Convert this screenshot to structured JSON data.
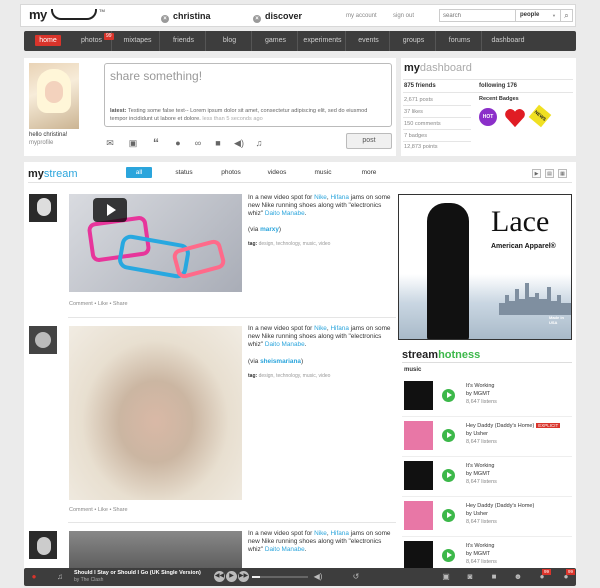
{
  "topbar": {
    "logo": "my",
    "logo_tm": "TM",
    "user1": "christina",
    "user2": "discover",
    "my_account": "my account",
    "sign_out": "sign out",
    "search_placeholder": "search",
    "search_scope": "people",
    "search_scope_arrow": "▼",
    "search_icon": "🔍"
  },
  "nav": {
    "items": [
      {
        "label": "home",
        "active": true
      },
      {
        "label": "photos",
        "badge": "99"
      },
      {
        "label": "mixtapes"
      },
      {
        "label": "friends"
      },
      {
        "label": "blog"
      },
      {
        "label": "games"
      },
      {
        "label": "experiments"
      },
      {
        "label": "events"
      },
      {
        "label": "groups"
      },
      {
        "label": "forums"
      },
      {
        "label": "dashboard"
      }
    ]
  },
  "share": {
    "hello": "hello christina!",
    "myprofile": "myprofile",
    "placeholder": "share something!",
    "latest_label": "latest:",
    "latest_text": "Testing some false text-- Lorem ipsum dolor sit amet, consectetur adipiscing elit, sed do eiusmod tempor incididunt ut labore et dolore.",
    "latest_time": "less than 5 seconds ago",
    "post_label": "post",
    "icons": [
      "mail-icon",
      "photo-icon",
      "quote-icon",
      "chat-icon",
      "link-icon",
      "video-icon",
      "audio-icon",
      "music-icon"
    ]
  },
  "dashboard": {
    "title_bold": "my",
    "title_light": "dashboard",
    "friends": "875 friends",
    "following": "following 176",
    "stats": [
      "2,671 posts",
      "37 likes",
      "150 comments",
      "7 badges",
      "12,873 points"
    ],
    "badges_title": "Recent Badges",
    "badge_hot": "HOT",
    "badge_news": "NEWS"
  },
  "stream": {
    "title_bold": "my",
    "title_light": "stream",
    "tabs": [
      "all",
      "status",
      "photos",
      "videos",
      "music",
      "more"
    ],
    "view_icons": [
      "▶",
      "▤",
      "▦"
    ],
    "posts": [
      {
        "text_pre": "In a new video spot for ",
        "link1": "Nike",
        "mid1": ", ",
        "link2": "Hifana",
        "text_mid": " jams on some new Nike running shoes along with \"electronics whiz\" ",
        "link3": "Daito Manabe",
        "text_end": ".",
        "via_pre": "(via ",
        "via_user": "marxy",
        "via_end": ")",
        "tags_label": "tag:",
        "tags": "design, technology, music, video",
        "actions": "Comment  •  Like  •  Share"
      },
      {
        "text_pre": "In a new video spot for ",
        "link1": "Nike",
        "mid1": ", ",
        "link2": "Hifana",
        "text_mid": " jams on some new Nike running shoes along with \"electronics whiz\" ",
        "link3": "Daito Manabe",
        "text_end": ".",
        "via_pre": "(via ",
        "via_user": "sheismariana",
        "via_end": ")",
        "tags_label": "tag:",
        "tags": "design, technology, music, video",
        "actions": "Comment  •  Like  •  Share"
      },
      {
        "text_pre": "In a new video spot for ",
        "link1": "Nike",
        "mid1": ", ",
        "link2": "Hifana",
        "text_mid": " jams on some new Nike running shoes along with \"electronics whiz\" ",
        "link3": "Daito Manabe",
        "text_end": "."
      }
    ]
  },
  "ad": {
    "title": "Lace",
    "subtitle": "American Apparel®",
    "badge": "Made in USA"
  },
  "hotness": {
    "title_bold": "stream",
    "title_green": "hotness",
    "music_label": "music",
    "tracks": [
      {
        "title": "It's Working",
        "artist": "by MGMT",
        "listens": "8,647 listens"
      },
      {
        "title": "Hey Daddy (Daddy's Home)",
        "artist": "by Usher",
        "listens": "8,647 listens",
        "explicit": "EXPLICIT"
      },
      {
        "title": "It's Working",
        "artist": "by MGMT",
        "listens": "8,647 listens"
      },
      {
        "title": "Hey Daddy (Daddy's Home)",
        "artist": "by Usher",
        "listens": "8,647 listens"
      },
      {
        "title": "It's Working",
        "artist": "by MGMT",
        "listens": "8,647 listens"
      }
    ]
  },
  "player": {
    "song": "Should I Stay or Should I Go (UK Single Version)",
    "artist": "by The Clash",
    "progress": 0.15,
    "badge1": "99",
    "badge2": "99"
  },
  "colors": {
    "accent": "#2ba5dc",
    "brand_red": "#d9342b",
    "green": "#3cb84a",
    "nav_bg": "#3d3d3d"
  }
}
